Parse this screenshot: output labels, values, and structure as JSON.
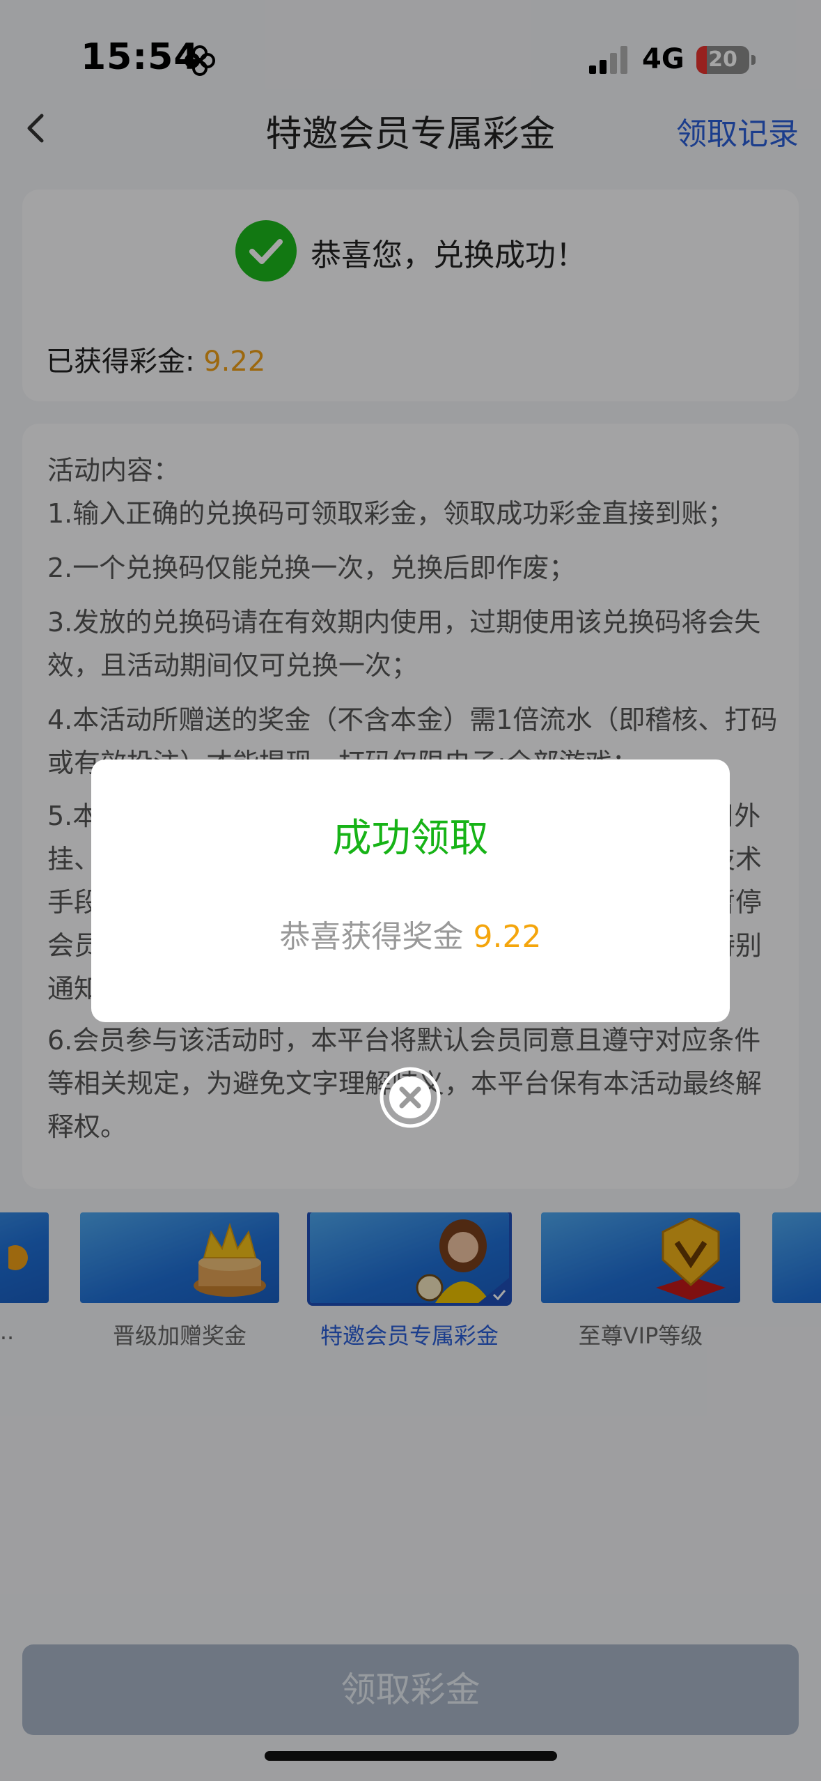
{
  "status_bar": {
    "time": "15:54",
    "network": "4G",
    "battery": "20",
    "battery_level": 0.2
  },
  "nav": {
    "title": "特邀会员专属彩金",
    "action": "领取记录"
  },
  "success": {
    "message": "恭喜您，兑换成功！",
    "earned_label": "已获得彩金: ",
    "earned_value": "9.22"
  },
  "rules": {
    "heading": "活动内容：",
    "items": [
      "1.输入正确的兑换码可领取彩金，领取成功彩金直接到账；",
      "2.一个兑换码仅能兑换一次，兑换后即作废；",
      "3.发放的兑换码请在有效期内使用，过期使用该兑换码将会失效，且活动期间仅可兑换一次；",
      "4.本活动所赠送的奖金（不含本金）需1倍流水（即稽核、打码或有效投注）才能提现，打码仅限电子:全部游戏；",
      "5.本活动仅限会员本人正常人为操作，禁止租借账号、使用外挂、机器人、不同账号对赌、互刷、套利、协议、漏洞、技术手段等行为，一经查实，平台将有权终止会员参与活动、暂停会员账号或扣除违规所得，并将违规会员列入风控名单，特别通知",
      "6.会员参与该活动时，本平台将默认会员同意且遵守对应条件等相关规定，为避免文字理解歧义，本平台保有本活动最终解释权。"
    ]
  },
  "carousel": {
    "items": [
      {
        "label": "..",
        "active": false
      },
      {
        "label": "晋级加赠奖金",
        "active": false
      },
      {
        "label": "特邀会员专属彩金",
        "active": true
      },
      {
        "label": "至尊VIP等级",
        "active": false
      }
    ]
  },
  "bottom_button": {
    "label": "领取彩金"
  },
  "dialog": {
    "title": "成功领取",
    "message": "恭喜获得奖金 ",
    "amount": "9.22"
  },
  "colors": {
    "accent_blue": "#2a5ed8",
    "success_green": "#17b317",
    "amount_orange": "#f4a50c"
  }
}
